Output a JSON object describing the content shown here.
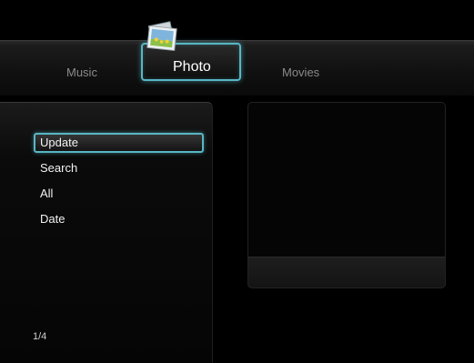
{
  "tabs": {
    "music": "Music",
    "photo": "Photo",
    "movies": "Movies",
    "active": "Photo"
  },
  "menu": {
    "items": [
      "Update",
      "Search",
      "All",
      "Date"
    ],
    "selected": "Update"
  },
  "pagination": "1/4",
  "colors": {
    "accent": "#58b6c5",
    "background": "#000000"
  },
  "icons": {
    "photo_tab": "photo-stack-icon"
  }
}
